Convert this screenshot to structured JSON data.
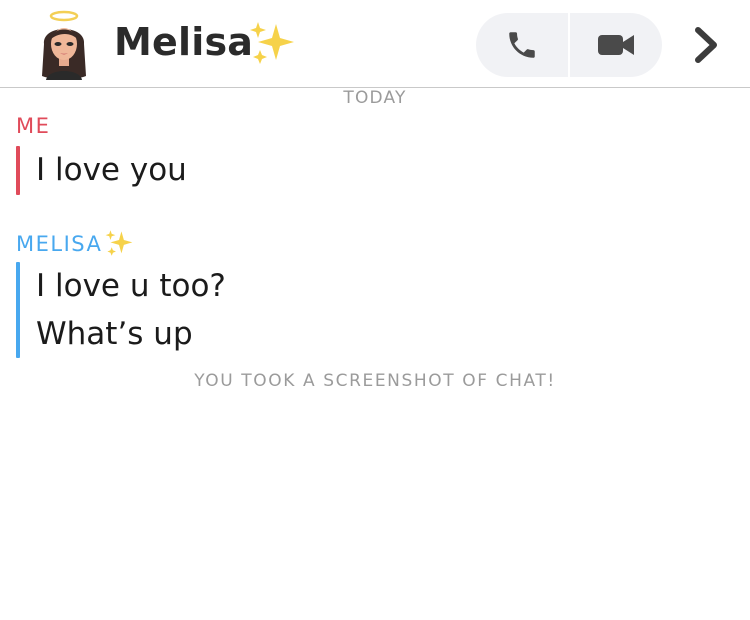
{
  "header": {
    "contact_name": "Melisa",
    "contact_emoji": "sparkles-icon",
    "avatar": "bitmoji-avatar-icon",
    "audio_call_icon": "phone-icon",
    "video_call_icon": "video-camera-icon",
    "more_icon": "chevron-right-icon"
  },
  "chat": {
    "date_separator": "TODAY",
    "groups": [
      {
        "sender": "ME",
        "color": "#e04b5a",
        "messages": [
          "I love you"
        ]
      },
      {
        "sender": "MELISA",
        "color": "#48a8ef",
        "messages": [
          "I love u too?",
          "What’s up"
        ]
      }
    ],
    "notice": "YOU TOOK A SCREENSHOT OF CHAT!"
  },
  "colors": {
    "me": "#e04b5a",
    "friend": "#48a8ef",
    "muted": "#9b9b9b",
    "call_bg": "#f1f2f5"
  }
}
